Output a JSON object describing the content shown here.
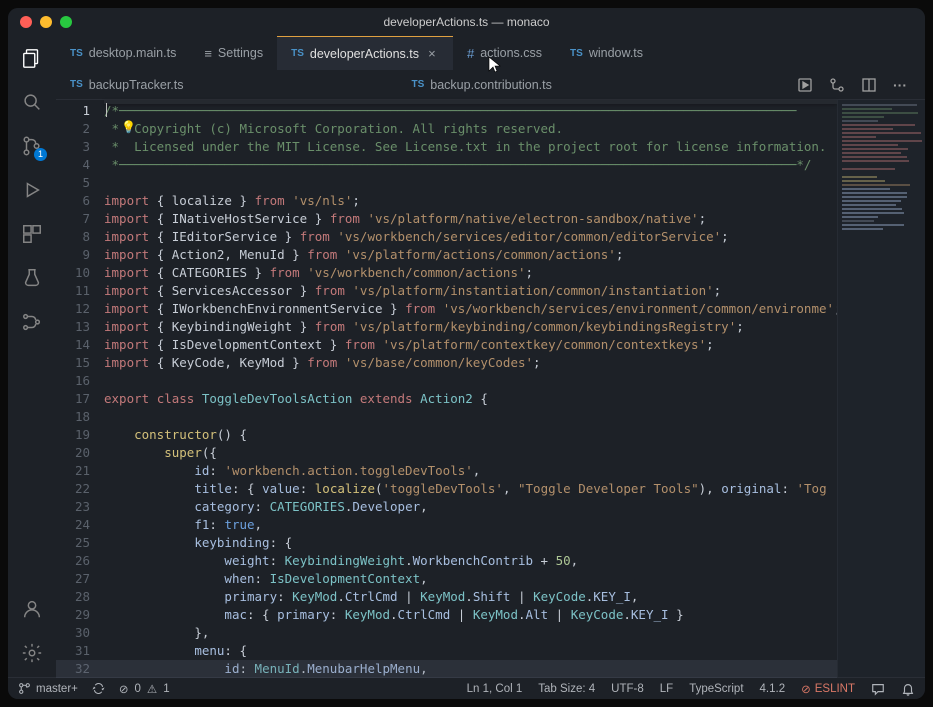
{
  "titlebar": {
    "title": "developerActions.ts — monaco"
  },
  "activitybar": {
    "scm_badge": "1"
  },
  "tabs": {
    "row1": [
      {
        "label": "desktop.main.ts",
        "kind": "ts",
        "active": false
      },
      {
        "label": "Settings",
        "kind": "settings",
        "active": false
      },
      {
        "label": "developerActions.ts",
        "kind": "ts",
        "active": true,
        "close": true
      },
      {
        "label": "actions.css",
        "kind": "css",
        "active": false
      },
      {
        "label": "window.ts",
        "kind": "ts",
        "active": false
      }
    ],
    "row2": [
      {
        "label": "backupTracker.ts",
        "kind": "ts"
      },
      {
        "label": "backup.contribution.ts",
        "kind": "ts"
      }
    ]
  },
  "code": {
    "lines": 32,
    "l2": " *  Copyright (c) Microsoft Corporation. All rights reserved.",
    "l3": " *  Licensed under the MIT License. See License.txt in the project root for license information.",
    "imports": [
      {
        "names": "localize",
        "from": "vs/nls"
      },
      {
        "names": "INativeHostService",
        "from": "vs/platform/native/electron-sandbox/native"
      },
      {
        "names": "IEditorService",
        "from": "vs/workbench/services/editor/common/editorService"
      },
      {
        "names": "Action2, MenuId",
        "from": "vs/platform/actions/common/actions"
      },
      {
        "names": "CATEGORIES",
        "from": "vs/workbench/common/actions"
      },
      {
        "names": "ServicesAccessor",
        "from": "vs/platform/instantiation/common/instantiation"
      },
      {
        "names": "IWorkbenchEnvironmentService",
        "from": "vs/workbench/services/environment/common/environme"
      },
      {
        "names": "KeybindingWeight",
        "from": "vs/platform/keybinding/common/keybindingsRegistry"
      },
      {
        "names": "IsDevelopmentContext",
        "from": "vs/platform/contextkey/common/contextkeys"
      },
      {
        "names": "KeyCode, KeyMod",
        "from": "vs/base/common/keyCodes"
      }
    ],
    "classLine": {
      "kw1": "export",
      "kw2": "class",
      "name": "ToggleDevToolsAction",
      "kw3": "extends",
      "base": "Action2"
    },
    "ctor": "constructor",
    "super": "super",
    "id_key": "id",
    "id_val": "'workbench.action.toggleDevTools'",
    "title_key": "title",
    "title_val_key": "value",
    "title_loc": "localize",
    "title_arg1": "'toggleDevTools'",
    "title_arg2": "\"Toggle Developer Tools\"",
    "title_orig": "original",
    "title_orig_v": "'Tog",
    "cat_key": "category",
    "cat_val1": "CATEGORIES",
    "cat_val2": "Developer",
    "f1_key": "f1",
    "f1_val": "true",
    "kb_key": "keybinding",
    "weight_key": "weight",
    "weight_v1": "KeybindingWeight",
    "weight_v2": "WorkbenchContrib",
    "weight_plus": "50",
    "when_key": "when",
    "when_v": "IsDevelopmentContext",
    "pri_key": "primary",
    "km": "KeyMod",
    "kc": "KeyCode",
    "cc": "CtrlCmd",
    "shift": "Shift",
    "alt": "Alt",
    "key_i": "KEY_I",
    "mac_key": "mac",
    "menu_key": "menu",
    "menu_id_key": "id",
    "menu_id_v1": "MenuId",
    "menu_id_v2": "MenubarHelpMenu"
  },
  "status": {
    "branch": "master+",
    "errors": "0",
    "warnings": "1",
    "pos": "Ln 1, Col 1",
    "tab": "Tab Size: 4",
    "enc": "UTF-8",
    "eol": "LF",
    "lang": "TypeScript",
    "ver": "4.1.2",
    "eslint": "ESLINT"
  }
}
